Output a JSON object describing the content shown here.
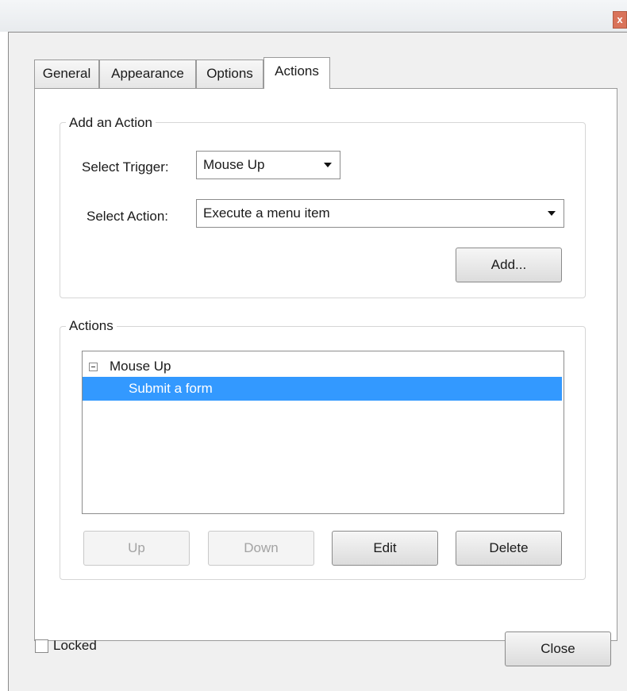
{
  "window": {
    "close_glyph": "x"
  },
  "tabs": [
    {
      "label": "General",
      "active": false
    },
    {
      "label": "Appearance",
      "active": false
    },
    {
      "label": "Options",
      "active": false
    },
    {
      "label": "Actions",
      "active": true
    }
  ],
  "add_action": {
    "group_title": "Add an Action",
    "trigger_label": "Select Trigger:",
    "trigger_value": "Mouse Up",
    "action_label": "Select Action:",
    "action_value": "Execute a menu item",
    "add_button": "Add..."
  },
  "actions": {
    "group_title": "Actions",
    "tree": {
      "parent": "Mouse Up",
      "children": [
        {
          "label": "Submit a form",
          "selected": true
        }
      ]
    },
    "buttons": {
      "up": "Up",
      "down": "Down",
      "edit": "Edit",
      "delete": "Delete"
    }
  },
  "footer": {
    "locked_label": "Locked",
    "locked_checked": false,
    "close_button": "Close"
  },
  "colors": {
    "selection": "#3399ff",
    "dialog_bg": "#f0f0f0"
  }
}
